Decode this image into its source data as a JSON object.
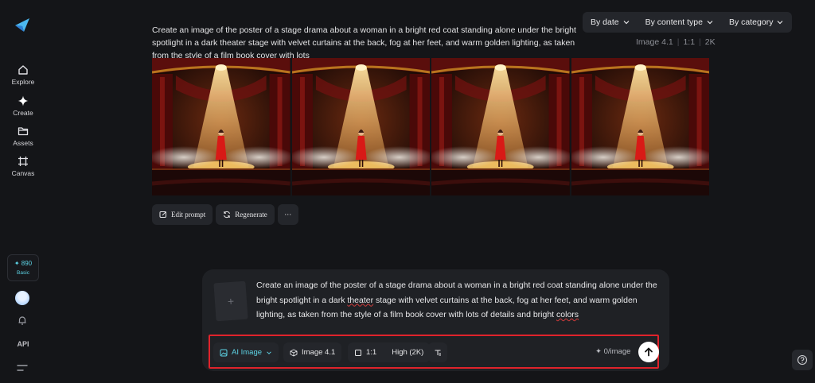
{
  "sidebar": {
    "logo_icon": "dreamina-logo-icon",
    "items": [
      {
        "label": "Explore",
        "icon": "home-icon"
      },
      {
        "label": "Create",
        "icon": "sparkle-icon"
      },
      {
        "label": "Assets",
        "icon": "folder-icon"
      },
      {
        "label": "Canvas",
        "icon": "canvas-icon"
      }
    ],
    "credits": {
      "value": "✦ 890",
      "tier": "Basic"
    },
    "api_label": "API"
  },
  "filters": [
    {
      "label": "By date"
    },
    {
      "label": "By content type"
    },
    {
      "label": "By category"
    }
  ],
  "history": {
    "prompt": "Create an image of the poster of a stage drama about a woman in a bright red coat standing alone under the bright spotlight in a dark theater stage with velvet curtains at the back, fog at her feet, and warm golden lighting, as taken from the style of a film book cover with lots",
    "meta": {
      "model": "Image 4.1",
      "ratio": "1:1",
      "quality": "2K"
    },
    "image_count": 4,
    "actions": {
      "edit_prompt": "Edit prompt",
      "regenerate": "Regenerate",
      "more": "···"
    }
  },
  "composer": {
    "upload_symbol": "+",
    "text_before": "Create an image of the poster of a stage drama about a woman in a bright red coat standing alone under the bright spotlight in a dark ",
    "misspelled": "theater",
    "text_middle": " stage with velvet curtains at the back, fog at her feet, and warm golden lighting, as taken from the style of a film book cover with lots of details and bright ",
    "misspelled2": "colors",
    "toolbar": {
      "mode": "AI Image",
      "model": "Image 4.1",
      "ratio": "1:1",
      "quality": "High (2K)",
      "cost": "✦ 0/image"
    }
  },
  "colors": {
    "background": "#141518",
    "accent": "#5dd4e6",
    "highlight_border": "#e0232b"
  }
}
